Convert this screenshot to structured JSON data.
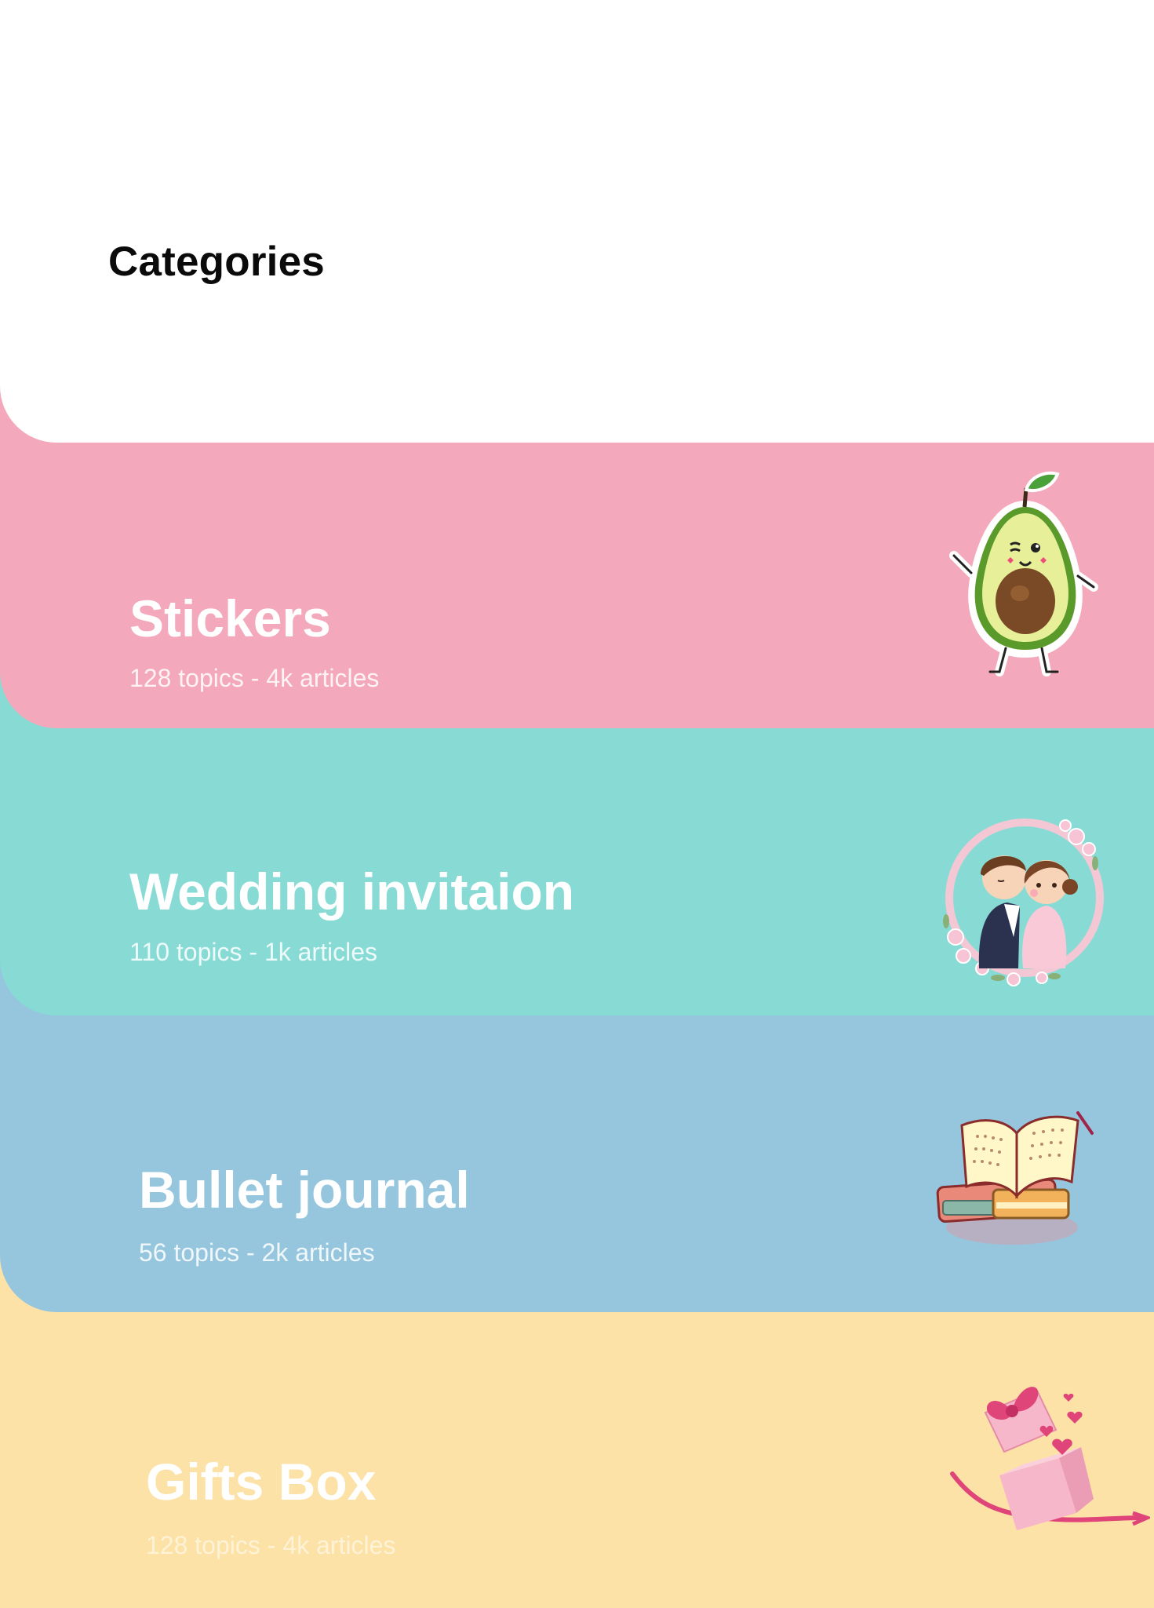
{
  "header": {
    "title": "Categories"
  },
  "categories": [
    {
      "title": "Stickers",
      "subtitle": "128 topics - 4k articles",
      "color": "#f4a8bb",
      "icon": "avocado-sticker-icon"
    },
    {
      "title": "Wedding invitaion",
      "subtitle": "110 topics - 1k articles",
      "color": "#87dbd4",
      "icon": "wedding-couple-icon"
    },
    {
      "title": "Bullet journal",
      "subtitle": "56 topics - 2k articles",
      "color": "#96c6de",
      "icon": "open-journal-books-icon"
    },
    {
      "title": "Gifts Box",
      "subtitle": "128 topics - 4k articles",
      "color": "#fde2a7",
      "icon": "gift-box-hearts-icon"
    }
  ]
}
